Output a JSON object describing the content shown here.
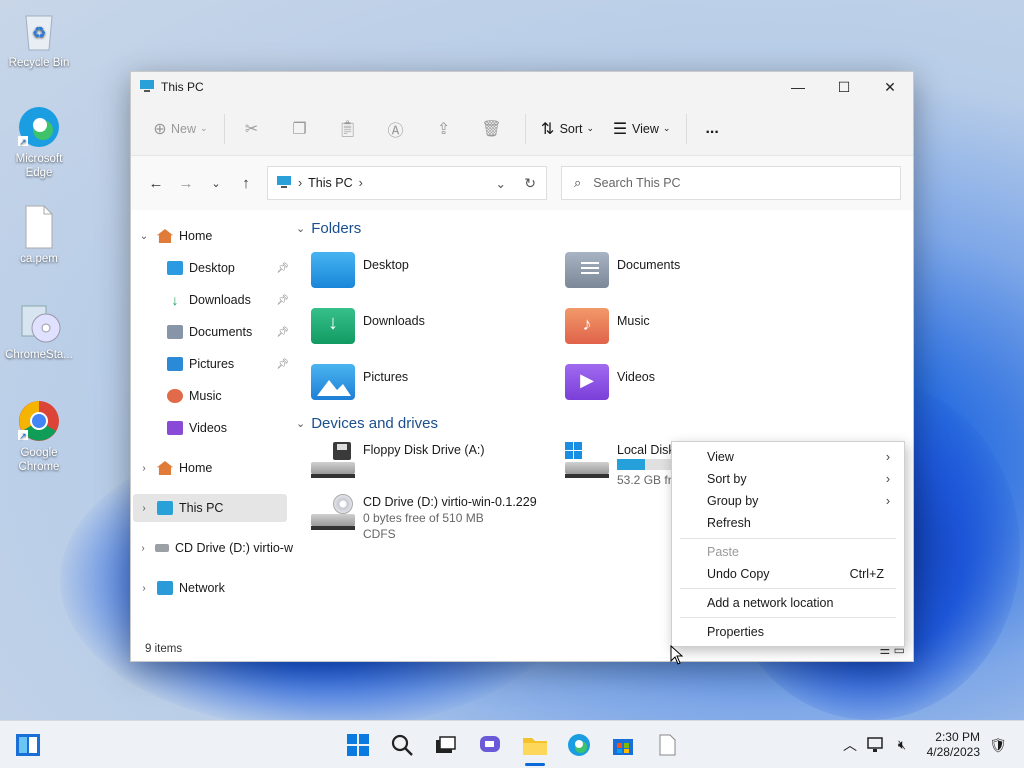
{
  "desktop": {
    "icons": [
      {
        "label": "Recycle Bin"
      },
      {
        "label": "Microsoft Edge"
      },
      {
        "label": "ca.pem"
      },
      {
        "label": "ChromeSta..."
      },
      {
        "label": "Google Chrome"
      }
    ]
  },
  "window": {
    "title": "This PC",
    "toolbar": {
      "new_label": "New",
      "sort_label": "Sort",
      "view_label": "View",
      "more_label": "..."
    },
    "address": {
      "path": "This PC",
      "search_placeholder": "Search This PC"
    },
    "sidebar": {
      "items": [
        {
          "label": "Home"
        },
        {
          "label": "Desktop"
        },
        {
          "label": "Downloads"
        },
        {
          "label": "Documents"
        },
        {
          "label": "Pictures"
        },
        {
          "label": "Music"
        },
        {
          "label": "Videos"
        },
        {
          "label": "Home"
        },
        {
          "label": "This PC"
        },
        {
          "label": "CD Drive (D:) virtio-w"
        },
        {
          "label": "Network"
        }
      ]
    },
    "content": {
      "folders_header": "Folders",
      "folders": [
        {
          "name": "Desktop"
        },
        {
          "name": "Documents"
        },
        {
          "name": "Downloads"
        },
        {
          "name": "Music"
        },
        {
          "name": "Pictures"
        },
        {
          "name": "Videos"
        }
      ],
      "drives_header": "Devices and drives",
      "drives": [
        {
          "name": "Floppy Disk Drive (A:)",
          "free": "",
          "fs": ""
        },
        {
          "name": "Local Disk",
          "free": "53.2 GB fre",
          "fs": ""
        },
        {
          "name": "CD Drive (D:) virtio-win-0.1.229",
          "free": "0 bytes free of 510 MB",
          "fs": "CDFS"
        }
      ],
      "local_disk_usage": 0.47
    },
    "status": {
      "item_count": "9 items"
    }
  },
  "context_menu": {
    "items": [
      {
        "label": "View",
        "shortcut": "",
        "submenu": true
      },
      {
        "label": "Sort by",
        "shortcut": "",
        "submenu": true
      },
      {
        "label": "Group by",
        "shortcut": "",
        "submenu": true
      },
      {
        "label": "Refresh",
        "shortcut": ""
      },
      {
        "label": "Paste",
        "shortcut": "",
        "disabled": true
      },
      {
        "label": "Undo Copy",
        "shortcut": "Ctrl+Z"
      },
      {
        "label": "Add a network location",
        "shortcut": ""
      },
      {
        "label": "Properties",
        "shortcut": ""
      }
    ]
  },
  "taskbar": {
    "time": "2:30 PM",
    "date": "4/28/2023"
  },
  "colors": {
    "accent": "#0078d4",
    "folder_blue": "#2b8fe0",
    "drive_bar": "#26a0da"
  }
}
